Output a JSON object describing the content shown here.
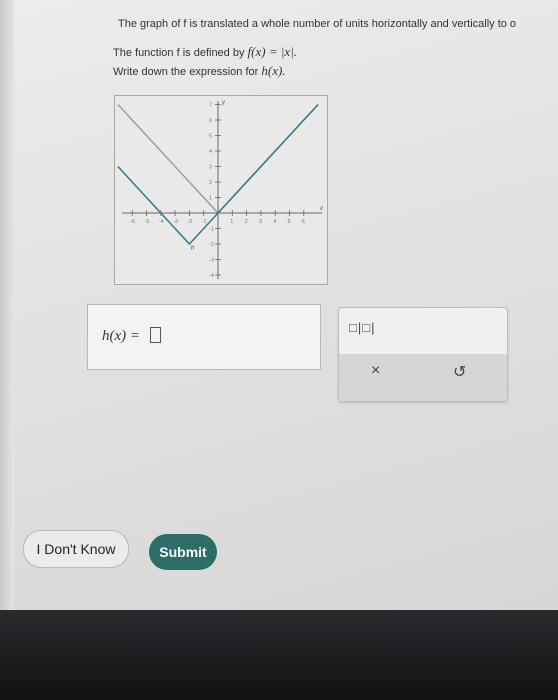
{
  "question": {
    "line1": "The graph of f is translated a whole number of units horizontally and vertically to o",
    "line2_prefix": "The function f is defined by",
    "line2_math": "f(x) = |x|.",
    "line3_prefix": "Write down the expression for",
    "line3_math": "h(x)."
  },
  "graph": {
    "x_ticks": [
      "-6",
      "-5",
      "-4",
      "-3",
      "-2",
      "-1",
      "1",
      "2",
      "3",
      "4",
      "5",
      "6"
    ],
    "y_ticks": [
      "7",
      "6",
      "5",
      "4",
      "3",
      "2",
      "1",
      "-1",
      "-2",
      "-3",
      "-4"
    ],
    "x_label": "x",
    "y_label": "y",
    "curve_label": "h",
    "gray_line_color": "#9e9e9e",
    "teal_line_color": "#2f7e82"
  },
  "answer": {
    "label": "h(x) =",
    "value": ""
  },
  "palette": {
    "abs_button": "□|□|",
    "clear_button": "×",
    "undo_button": "↺"
  },
  "buttons": {
    "dont_know": "I Don't Know",
    "submit": "Submit"
  }
}
